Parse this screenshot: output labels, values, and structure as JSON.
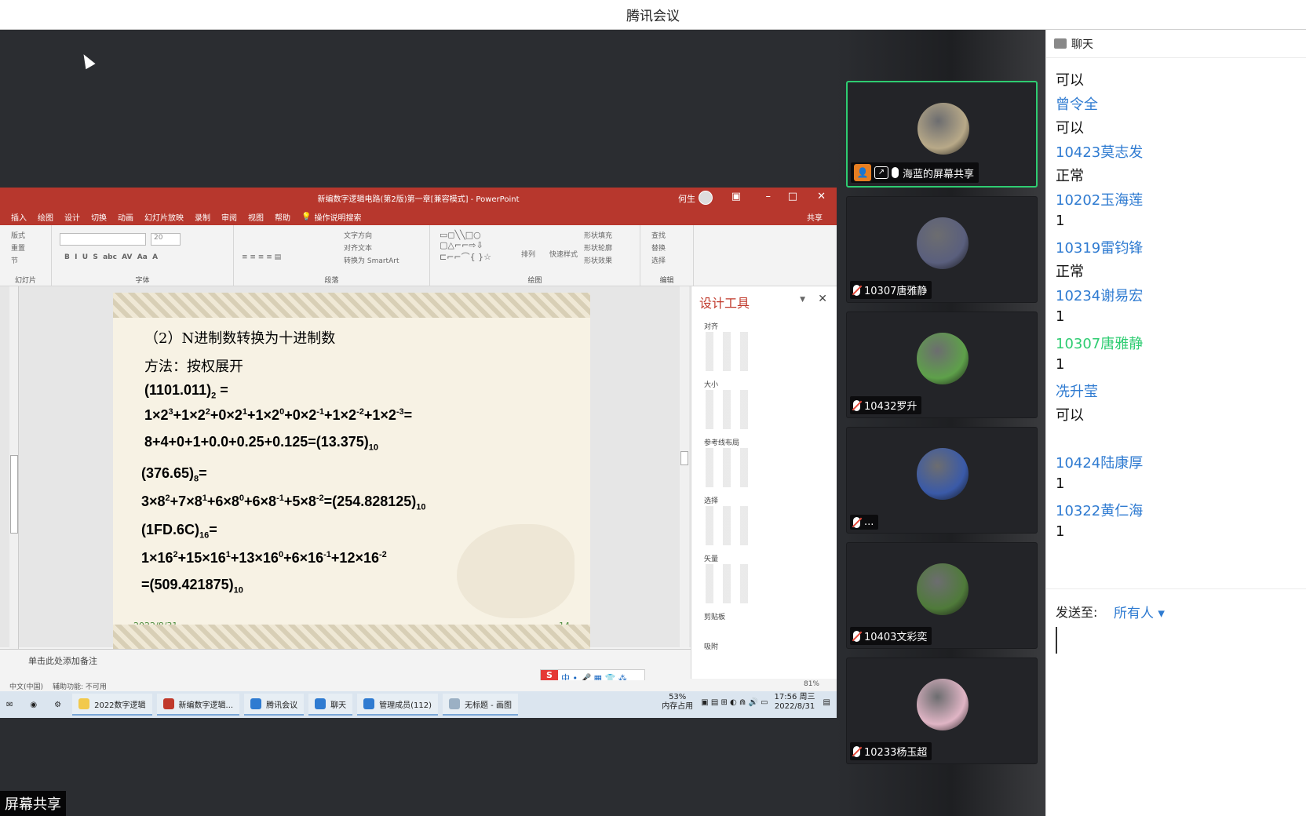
{
  "window": {
    "title": "腾讯会议"
  },
  "share_tag": "屏幕共享",
  "ppt": {
    "title": "新编数字逻辑电路(第2版)第一章[兼容模式] - PowerPoint",
    "user": "何生",
    "tabs": [
      "插入",
      "绘图",
      "设计",
      "切换",
      "动画",
      "幻灯片放映",
      "录制",
      "审阅",
      "视图",
      "帮助",
      "操作说明搜索"
    ],
    "share": "共享",
    "ribbon": {
      "slides_label": "幻灯片",
      "font_label": "字体",
      "font_size": "20",
      "para_label": "段落",
      "draw_label": "绘图",
      "edit_label": "编辑",
      "layout": "版式",
      "reset": "重置",
      "section": "节",
      "text_dir": "文字方向",
      "align_text": "对齐文本",
      "smartart": "转换为 SmartArt",
      "arrange": "排列",
      "quick_styles": "快速样式",
      "shape_fill": "形状填充",
      "shape_outline": "形状轮廓",
      "shape_effects": "形状效果",
      "find": "查找",
      "replace": "替换",
      "select": "选择"
    },
    "slide": {
      "heading": "（2）N进制数转换为十进制数",
      "method": "方法：按权展开",
      "date": "2022/8/31",
      "page": "14"
    },
    "design_pane": {
      "title": "设计工具",
      "sections": [
        "对齐",
        "大小",
        "参考线布局",
        "选择",
        "矢量",
        "剪贴板",
        "吸附"
      ]
    },
    "notes_placeholder": "单击此处添加备注",
    "status": {
      "lang": "中文(中国)",
      "access": "辅助功能: 不可用",
      "zoom": "81%"
    },
    "taskbar": {
      "items": [
        "2022数字逻辑",
        "新编数字逻辑...",
        "腾讯会议",
        "聊天",
        "管理成员(112)",
        "无标题 - 画图"
      ],
      "memory": "53%",
      "memory_label": "内存占用",
      "time": "17:56 周三",
      "date": "2022/8/31"
    }
  },
  "participants": [
    {
      "name": "海蓝的屏幕共享",
      "active": true,
      "avatar_color": "#b8a988"
    },
    {
      "name": "10307唐雅静",
      "active": false,
      "avatar_color": "#5a5f7d"
    },
    {
      "name": "10432罗升",
      "active": false,
      "avatar_color": "#5ea04a"
    },
    {
      "name": "...",
      "active": false,
      "avatar_color": "#3a5aa8"
    },
    {
      "name": "10403文彩奕",
      "active": false,
      "avatar_color": "#4f7a3a"
    },
    {
      "name": "10233杨玉超",
      "active": false,
      "avatar_color": "#e0b5c5"
    }
  ],
  "chat": {
    "title": "聊天",
    "messages": [
      {
        "kind": "body",
        "text": "可以"
      },
      {
        "kind": "sender",
        "text": "曾令全"
      },
      {
        "kind": "body",
        "text": "可以"
      },
      {
        "kind": "sender",
        "text": "10423莫志发"
      },
      {
        "kind": "body",
        "text": "正常"
      },
      {
        "kind": "sender",
        "text": "10202玉海莲"
      },
      {
        "kind": "body",
        "text": "1"
      },
      {
        "kind": "sender",
        "text": "10319雷钧锋"
      },
      {
        "kind": "body",
        "text": "正常"
      },
      {
        "kind": "sender",
        "text": "10234谢易宏"
      },
      {
        "kind": "body",
        "text": "1"
      },
      {
        "kind": "self",
        "text": "10307唐雅静"
      },
      {
        "kind": "body",
        "text": "1"
      },
      {
        "kind": "sender",
        "text": "冼升莹"
      },
      {
        "kind": "body",
        "text": "可以"
      },
      {
        "kind": "sender",
        "text": "10424陆康厚"
      },
      {
        "kind": "body",
        "text": "1"
      },
      {
        "kind": "sender",
        "text": "10322黄仁海"
      },
      {
        "kind": "body",
        "text": "1"
      }
    ],
    "send_to_label": "发送至:",
    "send_to_target": "所有人 ▾"
  }
}
